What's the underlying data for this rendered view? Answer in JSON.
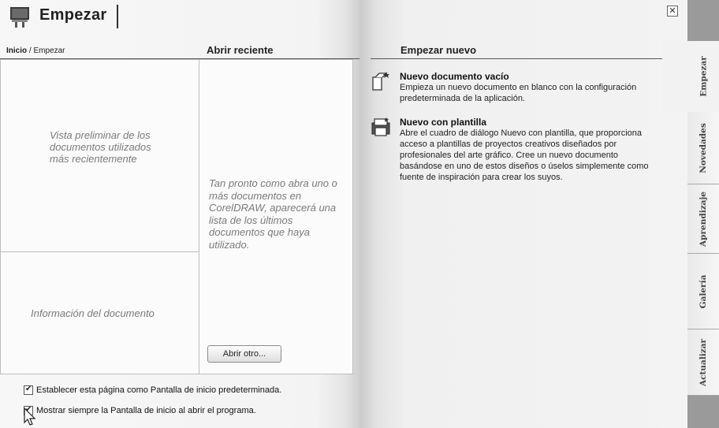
{
  "window": {
    "title": "Empezar"
  },
  "header": {
    "breadcrumb_home": "Inicio",
    "breadcrumb_sep": " / Empezar",
    "recent_title": "Abrir reciente",
    "new_title": "Empezar nuevo"
  },
  "left": {
    "preview_text": "Vista preliminar de los documentos utilizados más recientemente",
    "docinfo_text": "Información del documento"
  },
  "recent": {
    "empty_text": "Tan pronto como abra uno o más documentos en CorelDRAW, aparecerá una lista de los últimos documentos que haya utilizado.",
    "open_other_label": "Abrir otro..."
  },
  "new_items": [
    {
      "title": "Nuevo documento vacío",
      "description": "Empieza un nuevo documento en blanco con la configuración predeterminada de la aplicación.",
      "icon": "new-document-icon"
    },
    {
      "title": "Nuevo con plantilla",
      "description": "Abre el cuadro de diálogo Nuevo con plantilla, que proporciona acceso a plantillas de proyectos creativos diseñados por profesionales del arte gráfico. Cree un nuevo documento basándose en uno de estos diseños o úselos simplemente como fuente de inspiración para crear los suyos.",
      "icon": "template-icon"
    }
  ],
  "options": [
    {
      "label": "Establecer esta página como Pantalla de inicio predeterminada.",
      "checked": true
    },
    {
      "label": "Mostrar siempre la Pantalla de inicio al abrir el programa.",
      "checked": true
    }
  ],
  "tabs": [
    "Empezar",
    "Novedades",
    "Aprendizaje",
    "Galería",
    "Actualizar"
  ],
  "active_tab": "Empezar"
}
